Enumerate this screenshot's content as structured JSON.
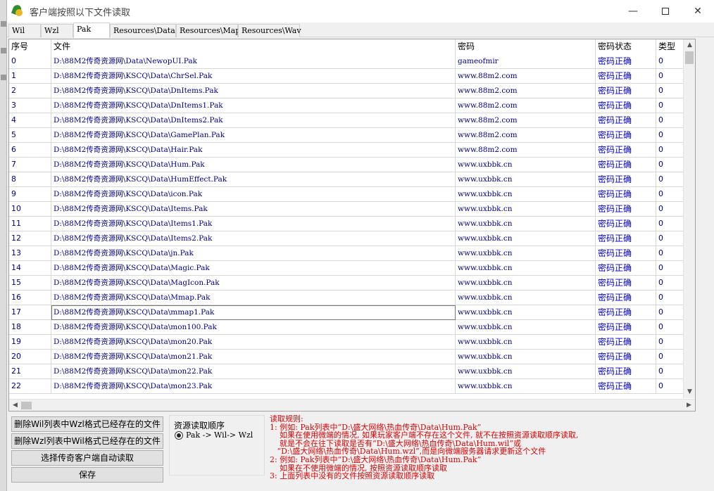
{
  "window": {
    "title": "客户端按照以下文件读取",
    "minimize": "—",
    "close": "✕"
  },
  "tabs": [
    "Wil",
    "Wzl",
    "Pak",
    "Resources\\Data",
    "Resources\\Map",
    "Resources\\Wav"
  ],
  "active_tab": "Pak",
  "table": {
    "headers": [
      "序号",
      "文件",
      "密码",
      "密码状态",
      "类型"
    ],
    "rows": [
      [
        "0",
        "D:\\88M2传奇资源网\\Data\\NewopUI.Pak",
        "gameofmir",
        "密码正确",
        "0"
      ],
      [
        "1",
        "D:\\88M2传奇资源网\\KSCQ\\Data\\ChrSel.Pak",
        "www.88m2.com",
        "密码正确",
        "0"
      ],
      [
        "2",
        "D:\\88M2传奇资源网\\KSCQ\\Data\\DnItems.Pak",
        "www.88m2.com",
        "密码正确",
        "0"
      ],
      [
        "3",
        "D:\\88M2传奇资源网\\KSCQ\\Data\\DnItems1.Pak",
        "www.88m2.com",
        "密码正确",
        "0"
      ],
      [
        "4",
        "D:\\88M2传奇资源网\\KSCQ\\Data\\DnItems2.Pak",
        "www.88m2.com",
        "密码正确",
        "0"
      ],
      [
        "5",
        "D:\\88M2传奇资源网\\KSCQ\\Data\\GamePlan.Pak",
        "www.88m2.com",
        "密码正确",
        "0"
      ],
      [
        "6",
        "D:\\88M2传奇资源网\\KSCQ\\Data\\Hair.Pak",
        "www.88m2.com",
        "密码正确",
        "0"
      ],
      [
        "7",
        "D:\\88M2传奇资源网\\KSCQ\\Data\\Hum.Pak",
        "www.uxbbk.cn",
        "密码正确",
        "0"
      ],
      [
        "8",
        "D:\\88M2传奇资源网\\KSCQ\\Data\\HumEffect.Pak",
        "www.uxbbk.cn",
        "密码正确",
        "0"
      ],
      [
        "9",
        "D:\\88M2传奇资源网\\KSCQ\\Data\\icon.Pak",
        "www.uxbbk.cn",
        "密码正确",
        "0"
      ],
      [
        "10",
        "D:\\88M2传奇资源网\\KSCQ\\Data\\Items.Pak",
        "www.uxbbk.cn",
        "密码正确",
        "0"
      ],
      [
        "11",
        "D:\\88M2传奇资源网\\KSCQ\\Data\\Items1.Pak",
        "www.uxbbk.cn",
        "密码正确",
        "0"
      ],
      [
        "12",
        "D:\\88M2传奇资源网\\KSCQ\\Data\\Items2.Pak",
        "www.uxbbk.cn",
        "密码正确",
        "0"
      ],
      [
        "13",
        "D:\\88M2传奇资源网\\KSCQ\\Data\\jn.Pak",
        "www.uxbbk.cn",
        "密码正确",
        "0"
      ],
      [
        "14",
        "D:\\88M2传奇资源网\\KSCQ\\Data\\Magic.Pak",
        "www.uxbbk.cn",
        "密码正确",
        "0"
      ],
      [
        "15",
        "D:\\88M2传奇资源网\\KSCQ\\Data\\MagIcon.Pak",
        "www.uxbbk.cn",
        "密码正确",
        "0"
      ],
      [
        "16",
        "D:\\88M2传奇资源网\\KSCQ\\Data\\Mmap.Pak",
        "www.uxbbk.cn",
        "密码正确",
        "0"
      ],
      [
        "17",
        "D:\\88M2传奇资源网\\KSCQ\\Data\\mmap1.Pak",
        "www.uxbbk.cn",
        "密码正确",
        "0"
      ],
      [
        "18",
        "D:\\88M2传奇资源网\\KSCQ\\Data\\mon100.Pak",
        "www.uxbbk.cn",
        "密码正确",
        "0"
      ],
      [
        "19",
        "D:\\88M2传奇资源网\\KSCQ\\Data\\mon20.Pak",
        "www.uxbbk.cn",
        "密码正确",
        "0"
      ],
      [
        "20",
        "D:\\88M2传奇资源网\\KSCQ\\Data\\mon21.Pak",
        "www.uxbbk.cn",
        "密码正确",
        "0"
      ],
      [
        "21",
        "D:\\88M2传奇资源网\\KSCQ\\Data\\mon22.Pak",
        "www.uxbbk.cn",
        "密码正确",
        "0"
      ],
      [
        "22",
        "D:\\88M2传奇资源网\\KSCQ\\Data\\mon23.Pak",
        "www.uxbbk.cn",
        "密码正确",
        "0"
      ]
    ],
    "selected_row": 17
  },
  "buttons": {
    "del_wil": "删除Wil列表中Wzl格式已经存在的文件",
    "del_wzl": "删除Wzl列表中Wil格式已经存在的文件",
    "choose_client": "选择传奇客户端自动读取",
    "save": "保存"
  },
  "order_group": {
    "title": "资源读取顺序",
    "option": "Pak -> Wil-> Wzl"
  },
  "rules": {
    "text": "读取规则:\n1: 例如: Pak列表中“D:\\盛大网络\\热血传奇\\Data\\Hum.Pak”\n    如果在使用微端的情况, 如果玩家客户端不存在这个文件, 就不在按照资源读取顺序读取,\n    就是不会在往下读取是否有“D:\\盛大网络\\热血传奇\\Data\\Hum.wil”或\n   “D:\\盛大网络\\热血传奇\\Data\\Hum.wzl”,而是向微端服务器请求更新这个文件\n2: 例如: Pak列表中“D:\\盛大网络\\热血传奇\\Data\\Hum.Pak”\n    如果在不使用微端的情况, 按照资源读取顺序读取\n3: 上面列表中没有的文件按照资源读取顺序读取"
  },
  "colors": {
    "rule_text": "#e00000",
    "cell_text": "#00008b",
    "status_text": "#0000cd"
  }
}
